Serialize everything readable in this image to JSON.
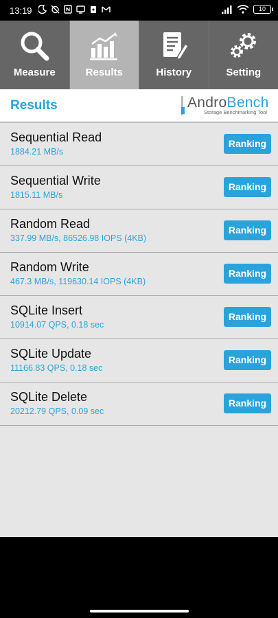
{
  "status": {
    "time": "13:19",
    "battery": "10"
  },
  "tabs": [
    {
      "label": "Measure",
      "icon": "magnifier-icon",
      "active": false
    },
    {
      "label": "Results",
      "icon": "bar-chart-icon",
      "active": true
    },
    {
      "label": "History",
      "icon": "document-pencil-icon",
      "active": false
    },
    {
      "label": "Setting",
      "icon": "gears-icon",
      "active": false
    }
  ],
  "header": {
    "title": "Results",
    "logo_part1": "Andro",
    "logo_part2": "Bench",
    "logo_tagline": "Storage Benchmarking Tool"
  },
  "results": [
    {
      "name": "Sequential Read",
      "value": "1884.21 MB/s",
      "button": "Ranking"
    },
    {
      "name": "Sequential Write",
      "value": "1815.11 MB/s",
      "button": "Ranking"
    },
    {
      "name": "Random Read",
      "value": "337.99 MB/s, 86526.98 IOPS (4KB)",
      "button": "Ranking"
    },
    {
      "name": "Random Write",
      "value": "467.3 MB/s, 119630.14 IOPS (4KB)",
      "button": "Ranking"
    },
    {
      "name": "SQLite Insert",
      "value": "10914.07 QPS, 0.18 sec",
      "button": "Ranking"
    },
    {
      "name": "SQLite Update",
      "value": "11166.83 QPS, 0.18 sec",
      "button": "Ranking"
    },
    {
      "name": "SQLite Delete",
      "value": "20212.79 QPS, 0.09 sec",
      "button": "Ranking"
    }
  ],
  "colors": {
    "accent": "#2aa3dc",
    "tab_bg": "#666666",
    "tab_active": "#b4b4b4",
    "list_bg": "#e6e6e6"
  }
}
